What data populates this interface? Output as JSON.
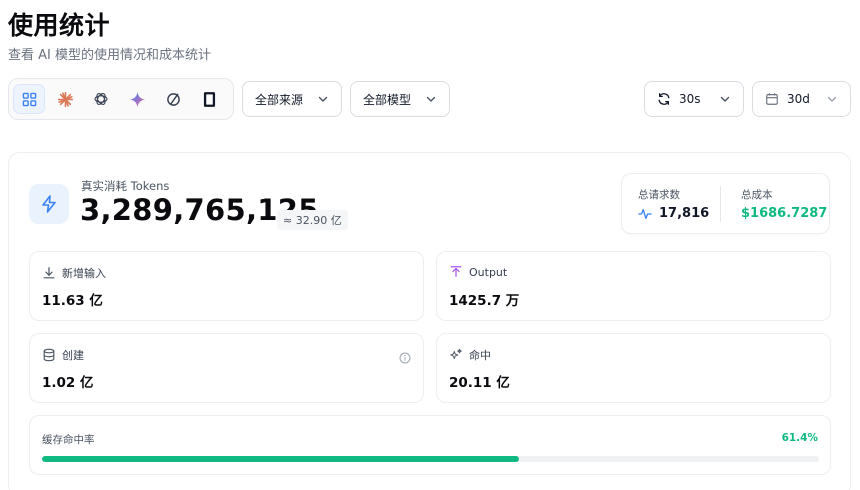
{
  "header": {
    "title": "使用统计",
    "subtitle": "查看 AI 模型的使用情况和成本统计"
  },
  "toolbar": {
    "providers": [
      {
        "name": "all-grid-icon",
        "active": true
      },
      {
        "name": "claude-sunburst-icon",
        "active": false
      },
      {
        "name": "openai-knot-icon",
        "active": false
      },
      {
        "name": "gemini-sparkle-icon",
        "active": false
      },
      {
        "name": "circle-slash-icon",
        "active": false
      },
      {
        "name": "device-frame-icon",
        "active": false
      }
    ],
    "source_select": "全部来源",
    "model_select": "全部模型",
    "refresh_select": "30s",
    "range_select": "30d"
  },
  "tokens": {
    "label": "真实消耗 Tokens",
    "value": "3,289,765,125",
    "approx": "≈ 32.90 亿"
  },
  "summary": {
    "requests_label": "总请求数",
    "requests_value": "17,816",
    "cost_label": "总成本",
    "cost_value": "$1686.7287"
  },
  "stats": {
    "input": {
      "label": "新增输入",
      "value": "11.63 亿"
    },
    "output": {
      "label": "Output",
      "value": "1425.7 万"
    },
    "create": {
      "label": "创建",
      "value": "1.02 亿"
    },
    "hit": {
      "label": "命中",
      "value": "20.11 亿"
    }
  },
  "cache_rate": {
    "label": "缓存命中率",
    "percent_text": "61.4%",
    "fraction": 0.614
  },
  "colors": {
    "accent_blue": "#3b82f6",
    "success_green": "#10b981",
    "output_purple": "#a855f7",
    "claude_orange": "#d97757"
  }
}
